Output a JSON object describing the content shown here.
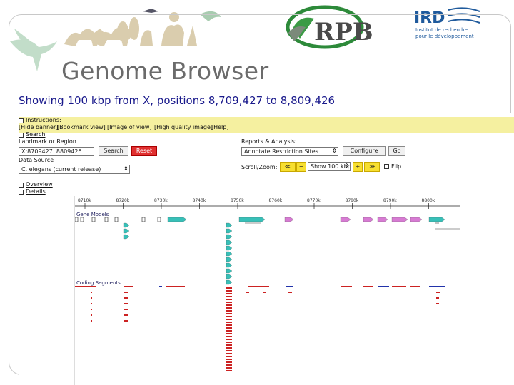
{
  "slide": {
    "title": "Genome Browser",
    "showing": "Showing 100 kbp from X, positions 8,709,427 to 8,809,426"
  },
  "logos": {
    "rpb_letters": "RPB",
    "ird_acronym": "IRD",
    "ird_line1": "Institut de recherche",
    "ird_line2": "pour le développement"
  },
  "browser": {
    "instructions_label": "Instructions:",
    "toolbar_links": [
      "[Hide banner]",
      "[Bookmark view]",
      "[Image of view]",
      "[High quality image]",
      "[Help]"
    ],
    "search_label": "Search",
    "landmark_label": "Landmark or Region",
    "landmark_value": "X:8709427..8809426",
    "search_button": "Search",
    "reset_button": "Reset",
    "data_source_label": "Data Source",
    "data_source_value": "C. elegans (current release)",
    "reports_label": "Reports & Analysis:",
    "reports_value": "Annotate Restriction Sites",
    "configure_button": "Configure",
    "go_button": "Go",
    "scroll_label": "Scroll/Zoom:",
    "zoom_value": "Show 100 kbp",
    "flip_label": "Flip",
    "overview_label": "Overview",
    "details_label": "Details",
    "tick_labels": [
      "8710k",
      "8720k",
      "8730k",
      "8740k",
      "8750k",
      "8760k",
      "8770k",
      "8780k",
      "8790k",
      "8800k"
    ],
    "gene_models_label": "Gene Models",
    "coding_segments_label": "Coding Segments"
  },
  "colors": {
    "gene_teal": "#37c0b8",
    "gene_magenta": "#d77bd3",
    "coding_red": "#cc2222",
    "coding_blue": "#2233aa",
    "instructions_bar": "#f5f0a0",
    "title_gray": "#6b6b6b",
    "showing_blue": "#1a1a8c",
    "reset_red": "#e03030",
    "zoom_yellow": "#f7df30"
  }
}
